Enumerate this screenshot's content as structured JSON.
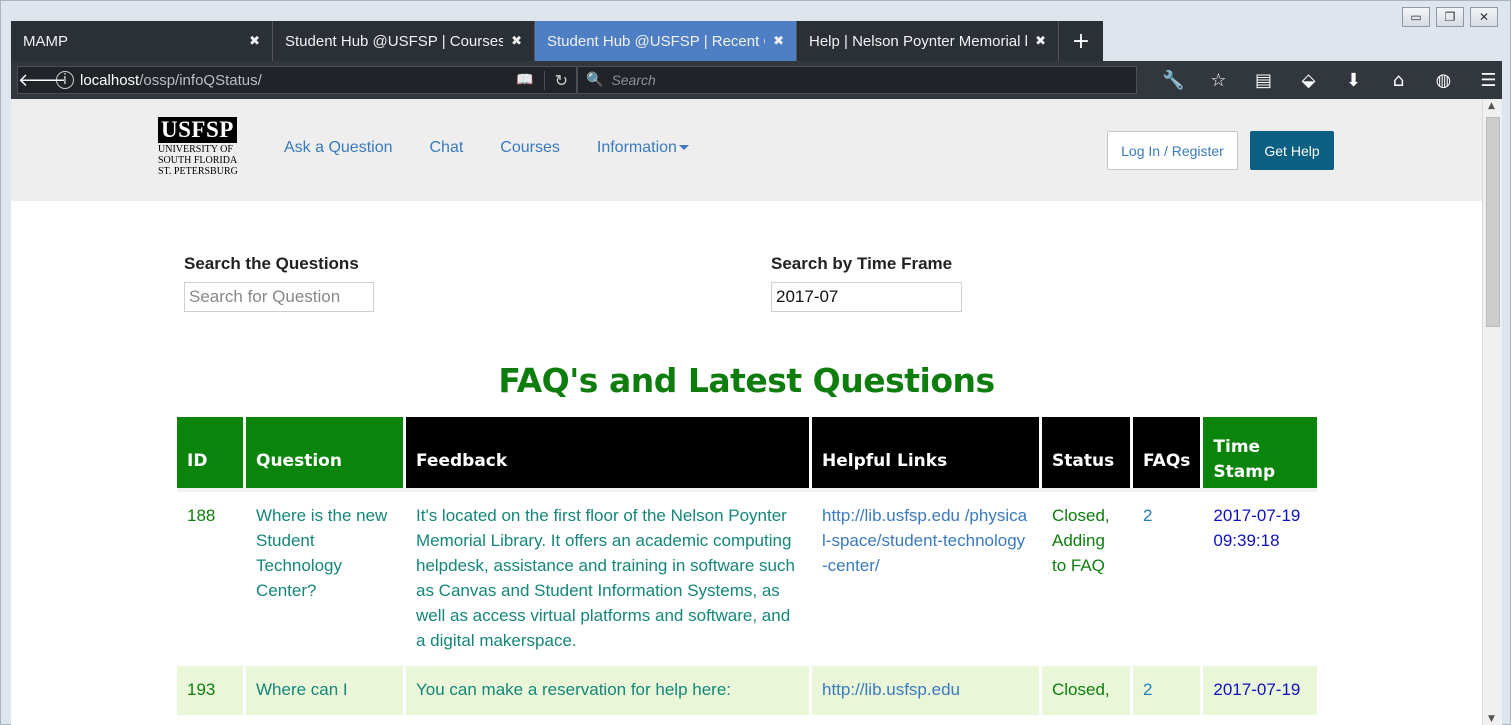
{
  "browser": {
    "tabs": [
      {
        "title": "MAMP",
        "active": false
      },
      {
        "title": "Student Hub @USFSP | Courses",
        "active": false
      },
      {
        "title": "Student Hub @USFSP | Recent Qu",
        "active": true
      },
      {
        "title": "Help | Nelson Poynter Memorial l",
        "active": false
      }
    ],
    "new_tab": "+",
    "close_glyph": "✖",
    "url_host": "localhost",
    "url_path": "/ossp/infoQStatus/",
    "search_placeholder": "Search",
    "window_controls": [
      "▭",
      "❐",
      "✕"
    ],
    "toolbar_icons": [
      {
        "name": "wrench-icon",
        "glyph": "🔧"
      },
      {
        "name": "star-icon",
        "glyph": "☆"
      },
      {
        "name": "library-icon",
        "glyph": "▤"
      },
      {
        "name": "pocket-icon",
        "glyph": "⬙"
      },
      {
        "name": "download-icon",
        "glyph": "⬇"
      },
      {
        "name": "home-icon",
        "glyph": "⌂"
      },
      {
        "name": "globe-icon",
        "glyph": "◍"
      },
      {
        "name": "menu-icon",
        "glyph": "☰"
      }
    ]
  },
  "site": {
    "logo": {
      "mark": "USFSP",
      "line1": "UNIVERSITY OF",
      "line2": "SOUTH FLORIDA",
      "line3": "ST. PETERSBURG"
    },
    "nav": [
      "Ask a Question",
      "Chat",
      "Courses",
      "Information"
    ],
    "login_label": "Log In / Register",
    "help_label": "Get Help"
  },
  "search": {
    "questions_label": "Search the Questions",
    "questions_placeholder": "Search for Question",
    "timeframe_label": "Search by Time Frame",
    "timeframe_value": "2017-07"
  },
  "page_title": "FAQ's and Latest Questions",
  "table": {
    "headers": {
      "id": "ID",
      "question": "Question",
      "feedback": "Feedback",
      "links": "Helpful Links",
      "status": "Status",
      "faqs": "FAQs",
      "time": "Time Stamp"
    },
    "rows": [
      {
        "id": "188",
        "question": "Where is the new Student Technology Center?",
        "feedback": "It's located on the first floor of the Nelson Poynter Memorial Library. It offers an academic computing helpdesk, assistance and training in software such as Canvas and Student Information Systems, as well as access virtual platforms and software, and a digital makerspace.",
        "link": "http://lib.usfsp.edu /physical-space/student-technology-center/",
        "status": "Closed, Adding to FAQ",
        "faqs": "2",
        "time": "2017-07-19 09:39:18"
      },
      {
        "id": "193",
        "question": "Where can I",
        "feedback": "You can make a reservation for help here:",
        "link": "http://lib.usfsp.edu",
        "status": "Closed,",
        "faqs": "2",
        "time": "2017-07-19"
      }
    ]
  },
  "colors": {
    "accent_green": "#0b840b",
    "link_blue": "#3a7abd",
    "help_button": "#0a5f82",
    "active_tab": "#4e7ec3"
  }
}
